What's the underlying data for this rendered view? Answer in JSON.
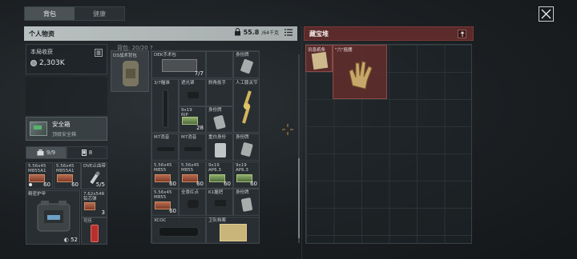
{
  "tabs": [
    {
      "label": "背包",
      "active": true
    },
    {
      "label": "健康",
      "active": false
    }
  ],
  "personal": {
    "title": "个人物资",
    "weight_value": "55.8",
    "weight_max": "/64千克"
  },
  "chest": {
    "title": "藏宝堆"
  },
  "harvest": {
    "label": "本局收获",
    "value": "2,303K"
  },
  "safebox": {
    "name": "安全箱",
    "sub": "顶级安全箱"
  },
  "counts": {
    "armor": "9/9",
    "other": "8"
  },
  "backpack_label": "背包: 20/20  ?",
  "left_items": [
    {
      "name": "5.56x45\nM855A1",
      "qty": "60"
    },
    {
      "name": "5.56x45\nM855A1",
      "qty": "60"
    },
    {
      "name": "DVE止血带",
      "qty": "5/5"
    },
    {
      "name": "精密护甲",
      "qty": "52"
    },
    {
      "name": "7.62x54R\n铅芯弹",
      "qty": "3"
    },
    {
      "name": "可乐",
      "qty": ""
    }
  ],
  "backpack_item": {
    "name": "D3战术背包"
  },
  "mid_items": [
    {
      "name": "DEK手术包",
      "qty": "7/7"
    },
    {
      "name": "身份牌",
      "qty": ""
    },
    {
      "name": "3/7瞄准",
      "qty": ""
    },
    {
      "name": "遮光罩",
      "qty": ""
    },
    {
      "name": "斜角扳手",
      "qty": ""
    },
    {
      "name": "人工膝关节",
      "qty": ""
    },
    {
      "name": "9x19\nRIP",
      "qty": "28"
    },
    {
      "name": "身份牌",
      "qty": ""
    },
    {
      "name": "M7消音",
      "qty": ""
    },
    {
      "name": "M7消音",
      "qty": ""
    },
    {
      "name": "重白身份",
      "qty": ""
    },
    {
      "name": "身份牌",
      "qty": ""
    },
    {
      "name": "5.56x45\nM855",
      "qty": "60"
    },
    {
      "name": "5.56x45\nM855",
      "qty": "60"
    },
    {
      "name": "9x19\nAP6.3",
      "qty": "60"
    },
    {
      "name": "9x19\nAP6.3",
      "qty": "60"
    },
    {
      "name": "5.56x45\nM855",
      "qty": "60"
    },
    {
      "name": "全景红点",
      "qty": ""
    },
    {
      "name": "K1握把",
      "qty": ""
    },
    {
      "name": "身份牌",
      "qty": ""
    },
    {
      "name": "XCOC",
      "qty": ""
    },
    {
      "name": "卫队档案",
      "qty": ""
    }
  ],
  "chest_items": [
    {
      "name": "讯息纸条"
    },
    {
      "name": "\"六\"摇摆"
    }
  ],
  "colors": {
    "chest_header": "#5b2a2a",
    "chest_item": "#5f2d2c",
    "personal_header": "#b9c0c0"
  }
}
